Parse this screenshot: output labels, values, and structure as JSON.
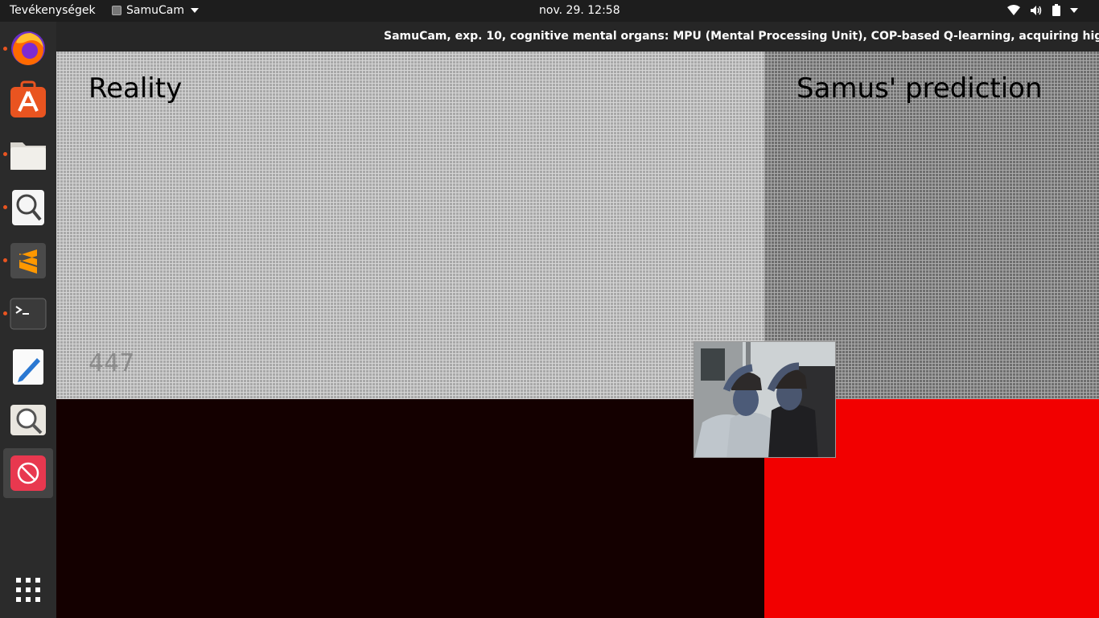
{
  "topbar": {
    "activities": "Tevékenységek",
    "app_name": "SamuCam",
    "clock": "nov. 29.  12:58"
  },
  "window": {
    "title": "SamuCam, exp. 10, cognitive mental organs: MPU (Mental Processing Unit), COP-based Q-learning, acquiring higher-order kno"
  },
  "content": {
    "reality_label": "Reality",
    "prediction_label": "Samus' prediction",
    "counter": "447"
  },
  "dock": {
    "items": [
      "firefox",
      "software-center",
      "files",
      "image-viewer",
      "sublime-text",
      "terminal",
      "text-editor",
      "magnifier",
      "samucam"
    ]
  },
  "colors": {
    "dark_area": "#140000",
    "red_area": "#f20000",
    "accent_dot": "#e95420"
  }
}
